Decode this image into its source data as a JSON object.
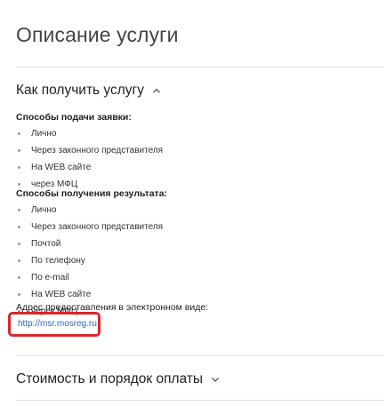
{
  "page_title": "Описание услуги",
  "sections": {
    "how_to_get": {
      "title": "Как получить услугу",
      "expanded": true
    },
    "cost": {
      "title": "Стоимость и порядок оплаты",
      "expanded": false
    }
  },
  "submission": {
    "title": "Способы подачи заявки:",
    "items": [
      "Лично",
      "Через законного представителя",
      "На WEB сайте",
      "через МФЦ"
    ]
  },
  "result": {
    "title": "Способы получения результата:",
    "items": [
      "Лично",
      "Через законного представителя",
      "Почтой",
      "По телефону",
      "По e-mail",
      "На WEB сайте",
      "через МФЦ"
    ]
  },
  "electronic": {
    "label": "Адрес предоставления в электронном виде:",
    "link": "http://msr.mosreg.ru"
  },
  "colors": {
    "link": "#2a6bb0",
    "highlight": "#d9262b",
    "divider": "#e3e3e3"
  },
  "icons": {
    "expanded": "chevron-up-icon",
    "collapsed": "chevron-down-icon"
  }
}
